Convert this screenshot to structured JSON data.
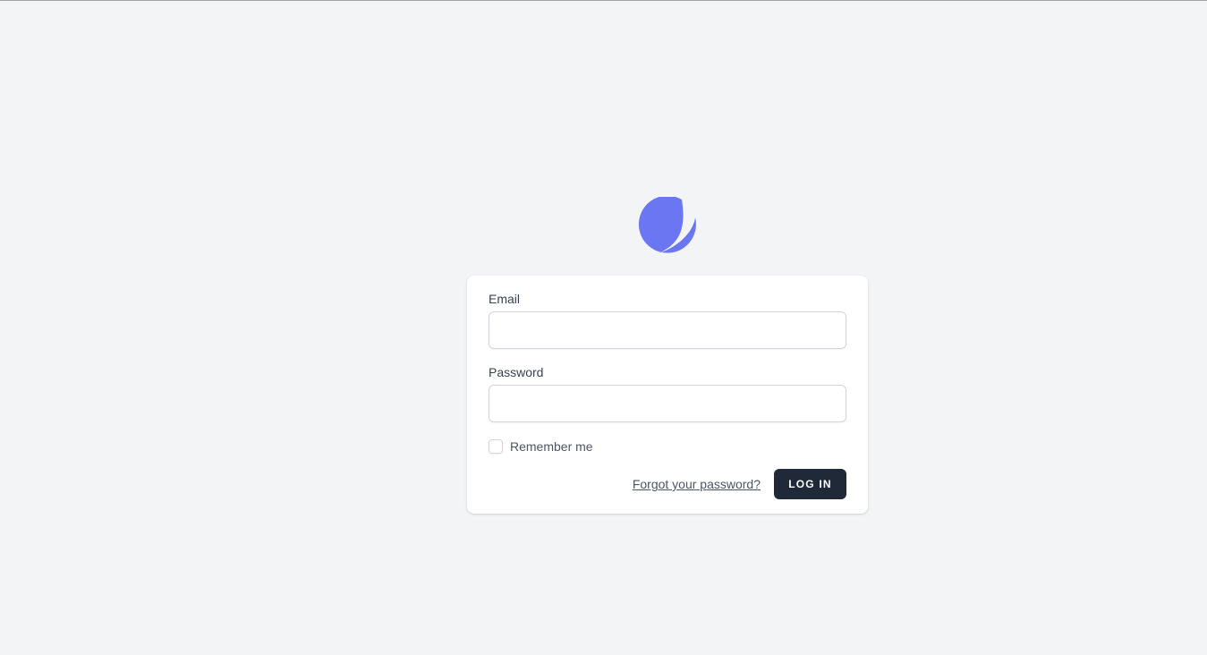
{
  "logo": {
    "icon": "planet-logo-icon",
    "color": "#6b77f2"
  },
  "form": {
    "email_label": "Email",
    "email_value": "",
    "password_label": "Password",
    "password_value": "",
    "remember_label": "Remember me",
    "remember_checked": false,
    "forgot_link": "Forgot your password?",
    "login_button": "LOG IN"
  },
  "colors": {
    "background": "#f3f4f6",
    "card": "#ffffff",
    "button": "#1f2937",
    "accent": "#6b77f2"
  }
}
